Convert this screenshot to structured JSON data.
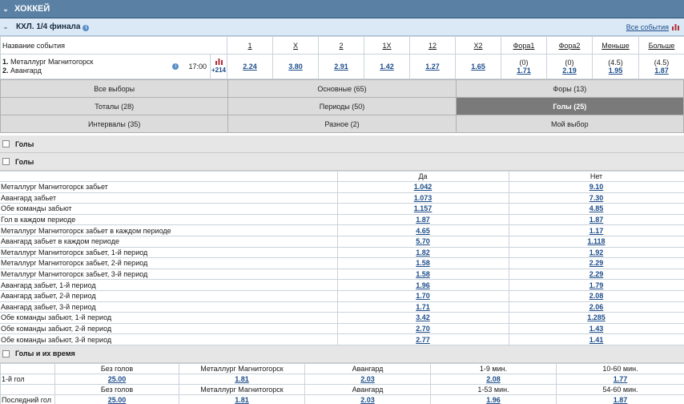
{
  "sport": {
    "title": "ХОККЕЙ"
  },
  "league": {
    "title": "КХЛ. 1/4 финала",
    "all_events_label": "Все события"
  },
  "odds_header": {
    "event_name_label": "Название события",
    "columns": [
      "1",
      "X",
      "2",
      "1X",
      "12",
      "X2",
      "Фора1",
      "Фора2",
      "Меньше",
      "Больше"
    ]
  },
  "event": {
    "team1_num": "1.",
    "team1": "Металлург Магнитогорск",
    "team2_num": "2.",
    "team2": "Авангард",
    "time": "17:00",
    "more_markets": "+214",
    "odds": [
      "2.24",
      "3.80",
      "2.91",
      "1.42",
      "1.27",
      "1.65"
    ],
    "fora1_hcp": "(0)",
    "fora1_odd": "1.71",
    "fora2_hcp": "(0)",
    "fora2_odd": "2.19",
    "under_total": "(4.5)",
    "under_odd": "1.95",
    "over_total": "(4.5)",
    "over_odd": "1.87"
  },
  "tabs": [
    [
      "Все выборы",
      "Основные (65)",
      "Форы (13)"
    ],
    [
      "Тоталы (28)",
      "Периоды (50)",
      "Голы (25)"
    ],
    [
      "Интервалы (35)",
      "Разное (2)",
      "Мой выбор"
    ]
  ],
  "active_tab": "Голы (25)",
  "section1_title": "Голы",
  "section2_title": "Голы",
  "goals_market": {
    "col_yes": "Да",
    "col_no": "Нет",
    "rows": [
      {
        "label": "Металлург Магнитогорск забьет",
        "yes": "1.042",
        "no": "9.10"
      },
      {
        "label": "Авангард забьет",
        "yes": "1.073",
        "no": "7.30"
      },
      {
        "label": "Обе команды забьют",
        "yes": "1.157",
        "no": "4.85"
      },
      {
        "label": "Гол в каждом периоде",
        "yes": "1.87",
        "no": "1.87"
      },
      {
        "label": "Металлург Магнитогорск забьет в каждом периоде",
        "yes": "4.65",
        "no": "1.17"
      },
      {
        "label": "Авангард забьет в каждом периоде",
        "yes": "5.70",
        "no": "1.118"
      },
      {
        "label": "Металлург Магнитогорск забьет, 1-й период",
        "yes": "1.82",
        "no": "1.92"
      },
      {
        "label": "Металлург Магнитогорск забьет, 2-й период",
        "yes": "1.58",
        "no": "2.29"
      },
      {
        "label": "Металлург Магнитогорск забьет, 3-й период",
        "yes": "1.58",
        "no": "2.29"
      },
      {
        "label": "Авангард забьет, 1-й период",
        "yes": "1.96",
        "no": "1.79"
      },
      {
        "label": "Авангард забьет, 2-й период",
        "yes": "1.70",
        "no": "2.08"
      },
      {
        "label": "Авангард забьет, 3-й период",
        "yes": "1.71",
        "no": "2.06"
      },
      {
        "label": "Обе команды забьют, 1-й период",
        "yes": "3.42",
        "no": "1.285"
      },
      {
        "label": "Обе команды забьют, 2-й период",
        "yes": "2.70",
        "no": "1.43"
      },
      {
        "label": "Обе команды забьют, 3-й период",
        "yes": "2.77",
        "no": "1.41"
      }
    ]
  },
  "section3_title": "Голы и их время",
  "goal_time": {
    "first": {
      "label": "1-й гол",
      "headers": [
        "Без голов",
        "Металлург Магнитогорск",
        "Авангард",
        "1-9 мин.",
        "10-60 мин."
      ],
      "values": [
        "25.00",
        "1.81",
        "2.03",
        "2.08",
        "1.77"
      ]
    },
    "last": {
      "label": "Последний гол",
      "headers": [
        "Без голов",
        "Металлург Магнитогорск",
        "Авангард",
        "1-53 мин.",
        "54-60 мин."
      ],
      "values": [
        "25.00",
        "1.81",
        "2.03",
        "1.96",
        "1.87"
      ]
    }
  },
  "colors": {
    "header_bg": "#5a81a4",
    "league_bg": "#dbe9f6",
    "active_tab_bg": "#7a7a7a",
    "link": "#1c4c8a",
    "chart_icon": "#b0303a"
  }
}
